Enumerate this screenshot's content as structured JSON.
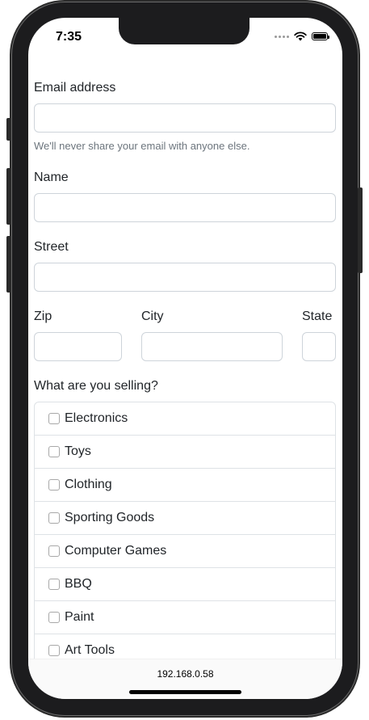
{
  "status_bar": {
    "time": "7:35",
    "icons": [
      "signal-dots-icon",
      "wifi-icon",
      "battery-icon"
    ]
  },
  "form": {
    "email": {
      "label": "Email address",
      "value": "",
      "help": "We'll never share your email with anyone else."
    },
    "name": {
      "label": "Name",
      "value": ""
    },
    "street": {
      "label": "Street",
      "value": ""
    },
    "zip": {
      "label": "Zip",
      "value": ""
    },
    "city": {
      "label": "City",
      "value": ""
    },
    "state": {
      "label": "State",
      "value": ""
    },
    "selling": {
      "label": "What are you selling?",
      "items": [
        {
          "label": "Electronics",
          "checked": false
        },
        {
          "label": "Toys",
          "checked": false
        },
        {
          "label": "Clothing",
          "checked": false
        },
        {
          "label": "Sporting Goods",
          "checked": false
        },
        {
          "label": "Computer Games",
          "checked": false
        },
        {
          "label": "BBQ",
          "checked": false
        },
        {
          "label": "Paint",
          "checked": false
        },
        {
          "label": "Art Tools",
          "checked": false
        }
      ]
    }
  },
  "browser": {
    "url": "192.168.0.58"
  },
  "colors": {
    "frame": "#1c1c1e",
    "input_border": "#ced4da",
    "help_text": "#6c757d",
    "text": "#212529"
  }
}
